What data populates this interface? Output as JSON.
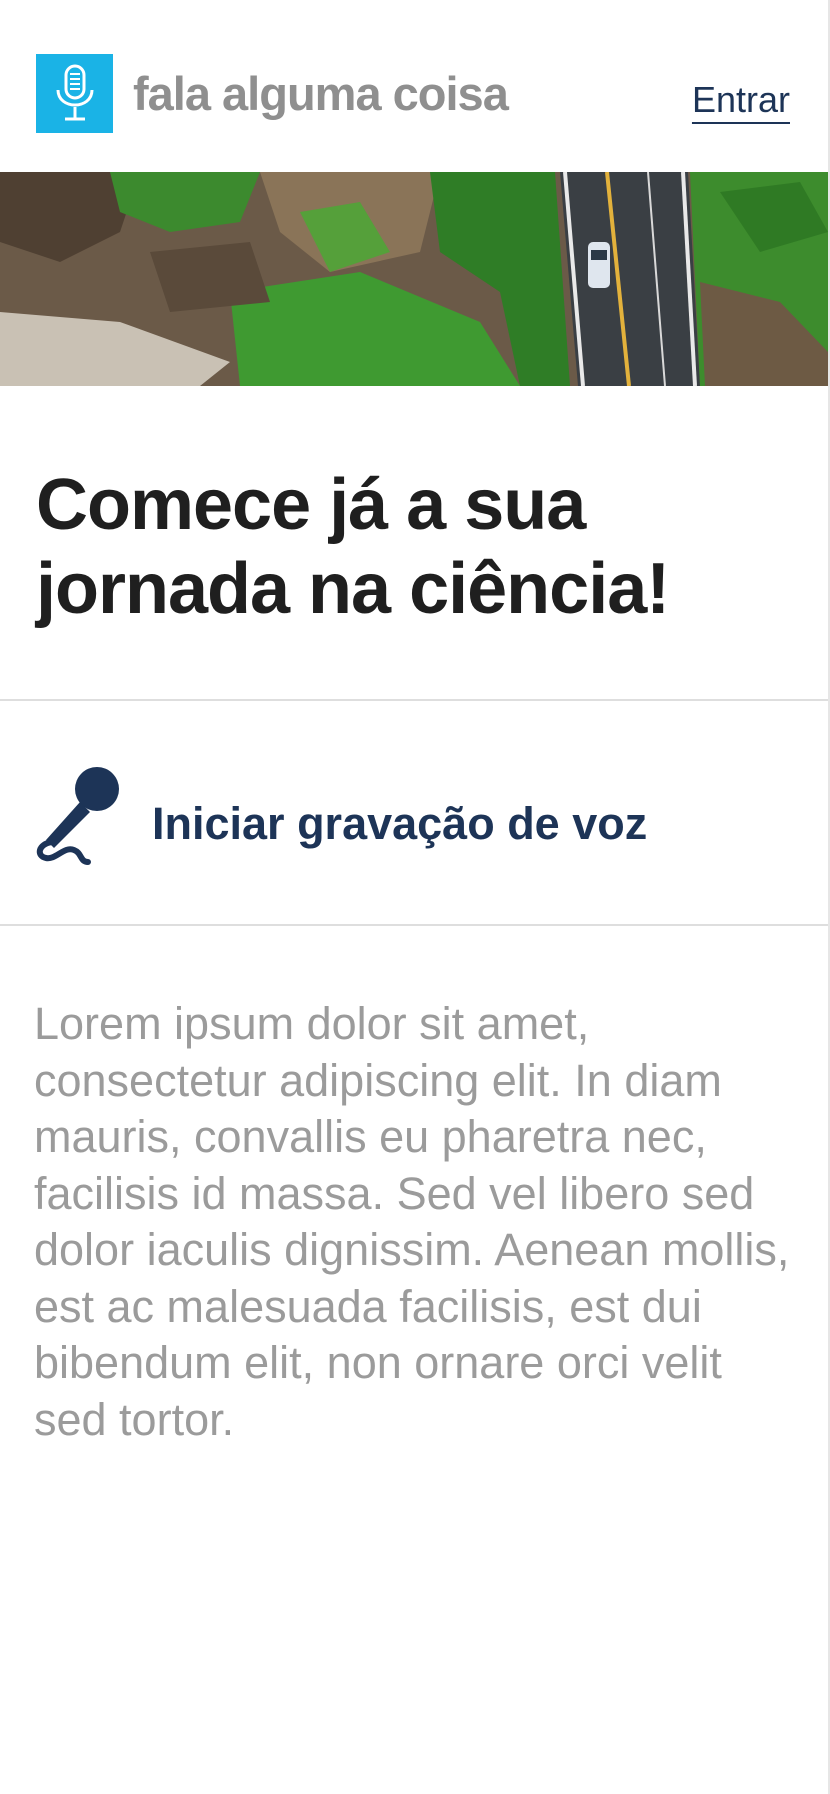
{
  "header": {
    "brand": "fala alguma coisa",
    "login_label": "Entrar",
    "logo_icon": "microphone-icon",
    "logo_color": "#1ab3e6"
  },
  "hero": {
    "image_description": "aerial-road-forest-image"
  },
  "main": {
    "headline": "Comece já a sua jornada na ciência!",
    "record": {
      "icon": "microphone-icon",
      "label": "Iniciar gravação de voz",
      "accent_color": "#1d3457"
    },
    "body": "Lorem ipsum dolor sit amet, consectetur adipiscing elit. In diam mauris, convallis eu pharetra nec, facilisis id massa. Sed vel libero sed dolor iaculis dignissim. Aenean mollis, est ac malesuada facilisis, est dui bibendum elit, non ornare orci velit sed tortor."
  }
}
